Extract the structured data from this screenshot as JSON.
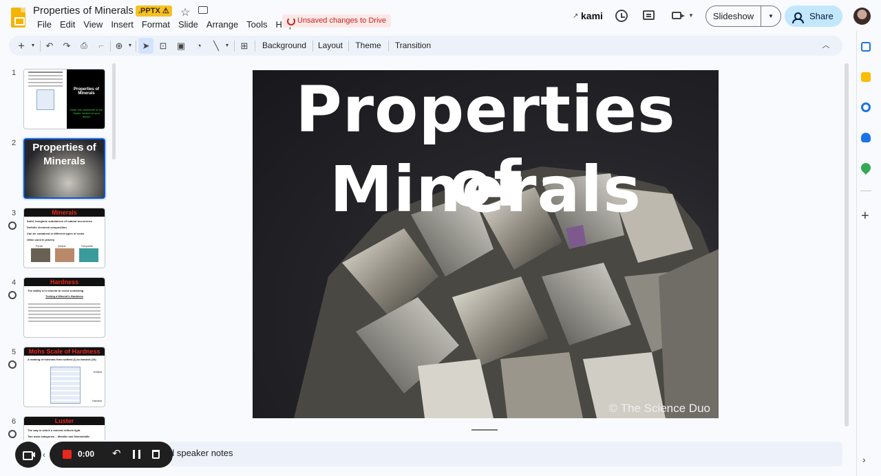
{
  "header": {
    "title": "Properties of Minerals",
    "file_badge": ".PPTX",
    "file_badge_icon": "warning-icon",
    "unsaved": "Unsaved changes to Drive",
    "kami": "kami",
    "slideshow_label": "Slideshow",
    "share_label": "Share",
    "menu": [
      "File",
      "Edit",
      "View",
      "Insert",
      "Format",
      "Slide",
      "Arrange",
      "Tools",
      "Help"
    ]
  },
  "toolbar": {
    "background": "Background",
    "layout": "Layout",
    "theme": "Theme",
    "transition": "Transition"
  },
  "filmstrip": {
    "numbers": [
      "1",
      "2",
      "3",
      "4",
      "5",
      "6"
    ],
    "thumb1": {
      "title": "Properties of Minerals",
      "subtitle": "Keep this worksheet in the 'Notes' section of your binder"
    },
    "thumb2": {
      "title": "Properties of Minerals"
    },
    "thumb3": {
      "title": "Minerals",
      "lines": [
        "Solid, inorganic substances of natural occurrence",
        "Definite chemical composition",
        "Can be contained in different types of rocks",
        "Often used in jewelry"
      ],
      "labels": [
        "Pyrite",
        "Quartz",
        "Turquoise"
      ]
    },
    "thumb4": {
      "title": "Hardness",
      "lines": [
        "The ability of a mineral to resist scratching",
        "Testing a Mineral's Hardness"
      ]
    },
    "thumb5": {
      "title": "Mohs Scale of Hardness",
      "lines": [
        "A ranking of minerals from softest (1) to hardest (10)"
      ],
      "side": [
        "Softest",
        "Hardest"
      ]
    },
    "thumb6": {
      "title": "Luster",
      "lines": [
        "The way in which a mineral reflects light",
        "Two main categories – Metallic and Nonmetallic"
      ]
    }
  },
  "slide": {
    "title_line1": "Properties of",
    "title_line2": "Minerals",
    "credit": "© The Science Duo"
  },
  "notes": {
    "text": "d speaker notes"
  },
  "recording": {
    "time": "0:00"
  },
  "colors": {
    "accent": "#0b57d0",
    "share_bg": "#c2e7ff",
    "unsaved": "#c5221f",
    "pptx_badge": "#f6c026"
  }
}
